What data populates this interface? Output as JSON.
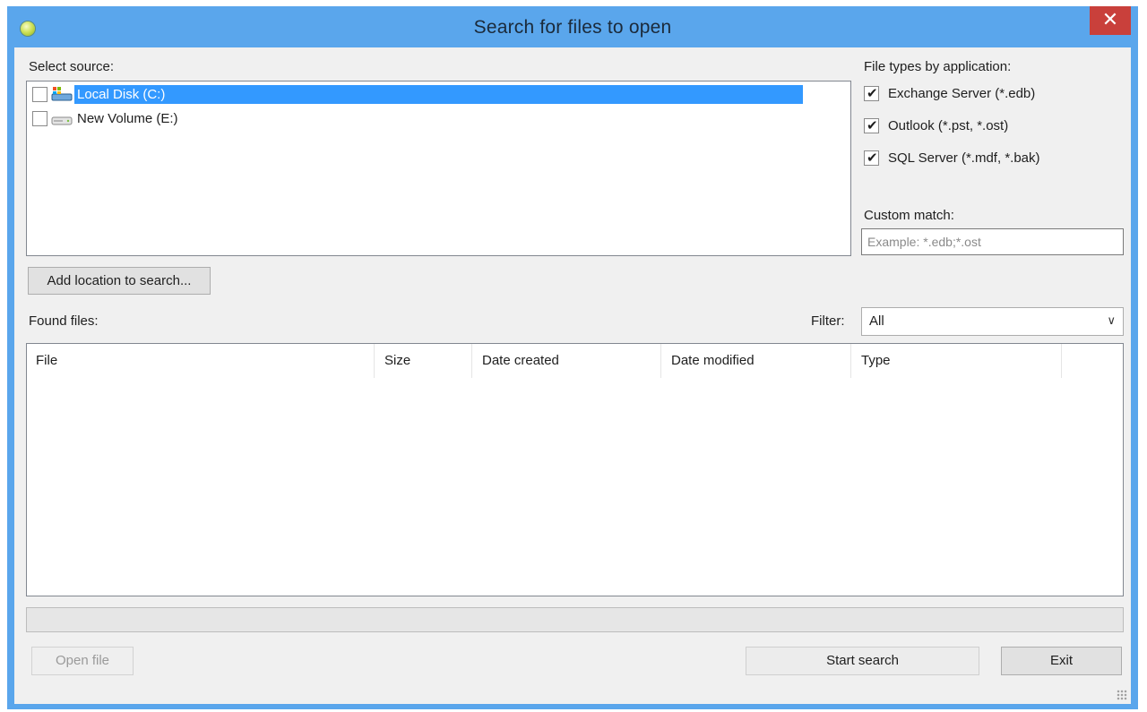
{
  "window": {
    "title": "Search for files to open",
    "close_symbol": "✕",
    "icon": "app-icon"
  },
  "source": {
    "label": "Select source:",
    "drives": [
      {
        "label": "Local Disk (C:)",
        "checked": false,
        "selected": true,
        "icon": "system-drive-icon"
      },
      {
        "label": "New Volume (E:)",
        "checked": false,
        "selected": false,
        "icon": "hard-drive-icon"
      }
    ],
    "add_location_label": "Add location to search..."
  },
  "file_types": {
    "label": "File types by application:",
    "items": [
      {
        "label": "Exchange Server (*.edb)",
        "checked": true
      },
      {
        "label": "Outlook (*.pst, *.ost)",
        "checked": true
      },
      {
        "label": "SQL Server (*.mdf, *.bak)",
        "checked": true
      }
    ],
    "custom_match_label": "Custom match:",
    "custom_match_placeholder": "Example: *.edb;*.ost",
    "custom_match_value": ""
  },
  "found": {
    "label": "Found files:",
    "filter_label": "Filter:",
    "filter_value": "All",
    "columns": [
      "File",
      "Size",
      "Date created",
      "Date modified",
      "Type"
    ],
    "rows": []
  },
  "progress": {
    "value": 0
  },
  "buttons": {
    "open_file": "Open file",
    "start_search": "Start search",
    "exit": "Exit"
  },
  "colors": {
    "titlebar": "#5aa6ec",
    "close": "#c9403b",
    "selection": "#3399ff"
  }
}
